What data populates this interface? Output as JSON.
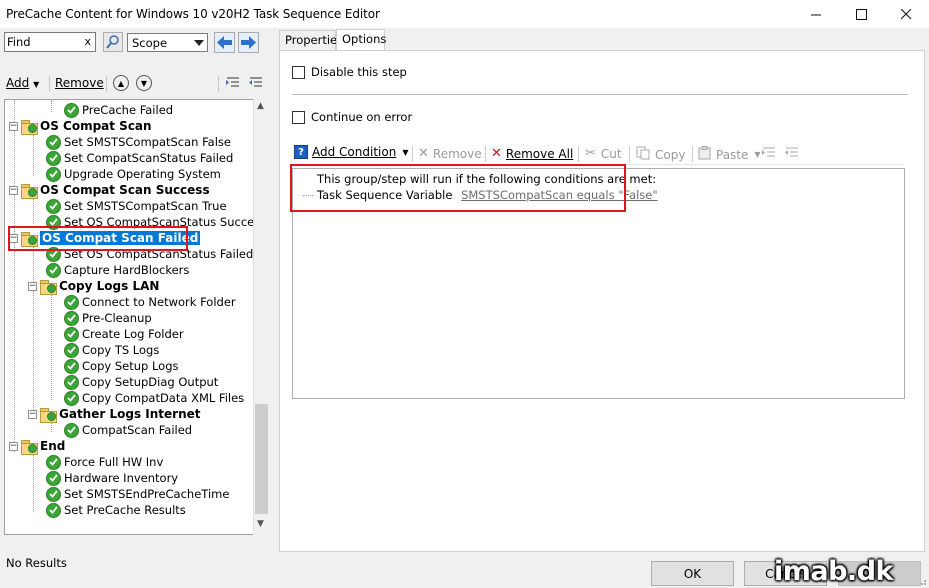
{
  "window": {
    "title": "PreCache Content for Windows 10 v20H2 Task Sequence Editor"
  },
  "search": {
    "value": "Find",
    "clear": "x",
    "scope": "Scope"
  },
  "tree_toolbar": {
    "add": "Add",
    "remove": "Remove"
  },
  "tree": [
    {
      "label": "PreCache Failed",
      "type": "step",
      "level": 3
    },
    {
      "label": "OS Compat Scan",
      "type": "group",
      "level": 1
    },
    {
      "label": "Set SMSTSCompatScan False",
      "type": "step",
      "level": 2
    },
    {
      "label": "Set CompatScanStatus Failed",
      "type": "step",
      "level": 2
    },
    {
      "label": "Upgrade Operating System",
      "type": "step",
      "level": 2
    },
    {
      "label": "OS Compat Scan Success",
      "type": "group",
      "level": 1
    },
    {
      "label": "Set SMSTSCompatScan True",
      "type": "step",
      "level": 2
    },
    {
      "label": "Set OS CompatScanStatus Success",
      "type": "step",
      "level": 2
    },
    {
      "label": "OS Compat Scan Failed",
      "type": "group",
      "level": 1,
      "selected": true
    },
    {
      "label": "Set OS CompatScanStatus Failed",
      "type": "step",
      "level": 2
    },
    {
      "label": "Capture HardBlockers",
      "type": "step",
      "level": 2
    },
    {
      "label": "Copy Logs LAN",
      "type": "group",
      "level": 2
    },
    {
      "label": "Connect to Network Folder",
      "type": "step",
      "level": 3
    },
    {
      "label": "Pre-Cleanup",
      "type": "step",
      "level": 3
    },
    {
      "label": "Create Log Folder",
      "type": "step",
      "level": 3
    },
    {
      "label": "Copy TS Logs",
      "type": "step",
      "level": 3
    },
    {
      "label": "Copy Setup Logs",
      "type": "step",
      "level": 3
    },
    {
      "label": "Copy SetupDiag Output",
      "type": "step",
      "level": 3
    },
    {
      "label": "Copy CompatData XML Files",
      "type": "step",
      "level": 3
    },
    {
      "label": "Gather Logs Internet",
      "type": "group",
      "level": 2
    },
    {
      "label": "CompatScan Failed",
      "type": "step",
      "level": 3
    },
    {
      "label": "End",
      "type": "group",
      "level": 1
    },
    {
      "label": "Force Full HW Inv",
      "type": "step",
      "level": 2
    },
    {
      "label": "Hardware Inventory",
      "type": "step",
      "level": 2
    },
    {
      "label": "Set SMSTSEndPreCacheTime",
      "type": "step",
      "level": 2
    },
    {
      "label": "Set PreCache Results",
      "type": "step",
      "level": 2
    }
  ],
  "tabs": [
    {
      "label": "Properties",
      "active": false
    },
    {
      "label": "Options",
      "active": true
    }
  ],
  "options": {
    "disable_step": "Disable this step",
    "continue_on_error": "Continue on error"
  },
  "cond_toolbar": {
    "add_condition": "Add Condition",
    "remove": "Remove",
    "remove_all": "Remove All",
    "cut": "Cut",
    "copy": "Copy",
    "paste": "Paste"
  },
  "conditions": {
    "intro": "This group/step will run if the following conditions are met:",
    "item_label": "Task Sequence Variable",
    "item_link": "SMSTSCompatScan equals \"False\""
  },
  "status": {
    "text": "No Results"
  },
  "buttons": {
    "ok": "OK",
    "cancel": "Cancel"
  },
  "watermark": "imab.dk",
  "colors": {
    "selection": "#0078d7",
    "highlight_box": "#e0141e",
    "step_ok": "#3aa535"
  }
}
